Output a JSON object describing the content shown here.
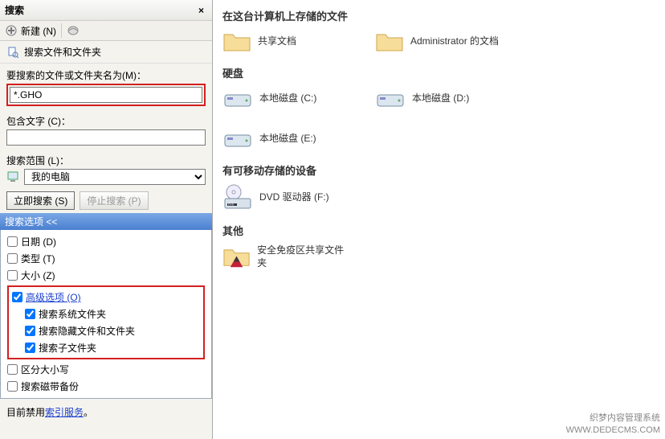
{
  "sidebar": {
    "title": "搜索",
    "close": "×",
    "new_label": "新建 (N)",
    "nav_label": "搜索文件和文件夹",
    "filename_label": "要搜索的文件或文件夹名为(M)：",
    "filename_value": "*.GHO",
    "contains_label": "包含文字 (C)：",
    "contains_value": "",
    "scope_label": "搜索范围 (L)：",
    "scope_value": "我的电脑",
    "search_btn": "立即搜索 (S)",
    "stop_btn": "停止搜索 (P)",
    "options_header": "搜索选项 <<",
    "opt_date": "日期 (D)",
    "opt_type": "类型 (T)",
    "opt_size": "大小 (Z)",
    "opt_adv": "高级选项 (O)",
    "opt_sys": "搜索系统文件夹",
    "opt_hidden": "搜索隐藏文件和文件夹",
    "opt_sub": "搜索子文件夹",
    "opt_case": "区分大小写",
    "opt_tape": "搜索磁带备份",
    "footer_prefix": "目前禁用",
    "footer_link": "索引服务",
    "footer_suffix": "。"
  },
  "main": {
    "section1_title": "在这台计算机上存储的文件",
    "folder1": "共享文档",
    "folder2": "Administrator 的文档",
    "section2_title": "硬盘",
    "drive_c": "本地磁盘 (C:)",
    "drive_d": "本地磁盘 (D:)",
    "drive_e": "本地磁盘 (E:)",
    "section3_title": "有可移动存储的设备",
    "dvd": "DVD 驱动器 (F:)",
    "section4_title": "其他",
    "safe": "安全免疫区共享文件夹"
  },
  "watermark": {
    "line1": "织梦内容管理系统",
    "line2": "WWW.DEDECMS.COM"
  }
}
